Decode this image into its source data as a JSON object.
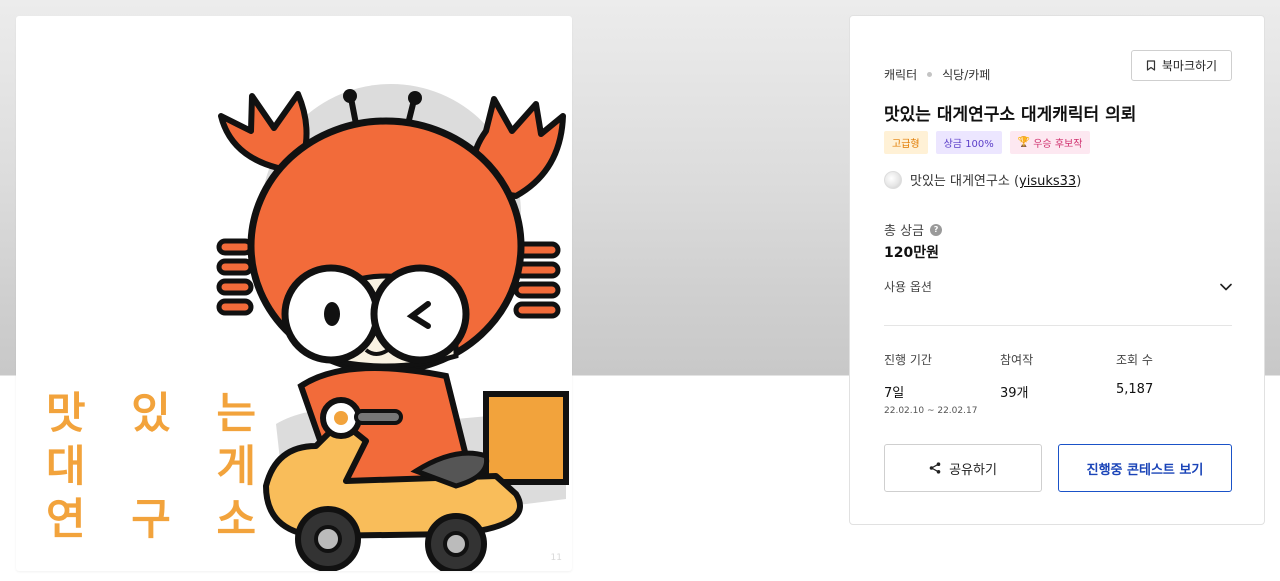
{
  "image": {
    "logo_rows": [
      [
        "맛",
        "있",
        "는"
      ],
      [
        "대",
        "",
        "게"
      ],
      [
        "연",
        "구",
        "소"
      ]
    ],
    "watermark": "11",
    "colors": {
      "crab": "#f26b3a",
      "scooter": "#f2a33c",
      "outline": "#111111",
      "logo_text": "#f2a33c"
    }
  },
  "contest": {
    "breadcrumbs": [
      "캐릭터",
      "식당/카페"
    ],
    "bookmark_label": "북마크하기",
    "bookmark_icon": "bookmark-icon",
    "title": "맛있는 대게연구소 대게캐릭터 의뢰",
    "badges": {
      "grade": "고급형",
      "prize": "상금 100%",
      "winner": "우승 후보작",
      "winner_icon": "trophy-icon"
    },
    "host_name": "맛있는 대게연구소",
    "host_id": "yisuks33",
    "total_prize_label": "총 상금",
    "total_prize_value": "120만원",
    "usage_options_label": "사용 옵션",
    "stats": {
      "period_label": "진행 기간",
      "period_value": "7일",
      "period_range": "22.02.10 ~ 22.02.17",
      "entries_label": "참여작",
      "entries_value": "39개",
      "views_label": "조회 수",
      "views_value": "5,187"
    },
    "share_label": "공유하기",
    "share_icon": "share-icon",
    "view_button_label": "진행중 콘테스트 보기",
    "accent_color": "#1a44b8"
  }
}
